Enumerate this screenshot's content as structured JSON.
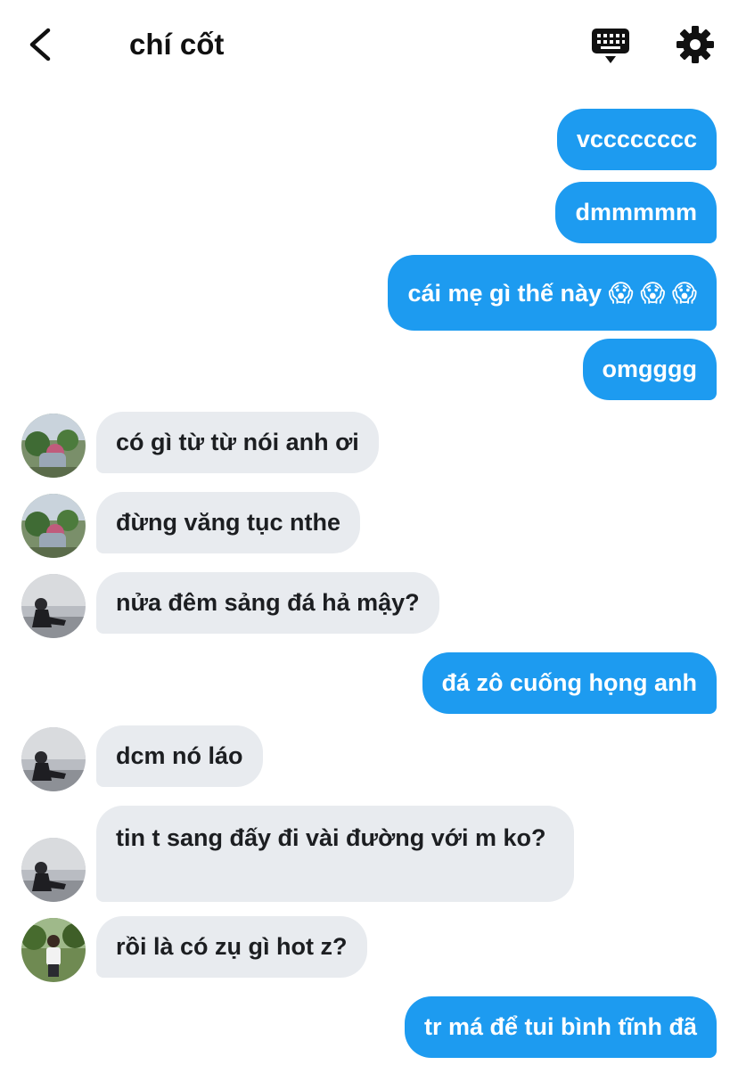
{
  "header": {
    "title": "chí cốt",
    "back_icon": "chevron-left-icon",
    "keyboard_icon": "keyboard-icon",
    "settings_icon": "gear-icon"
  },
  "colors": {
    "outgoing_bubble": "#1d9bf0",
    "incoming_bubble": "#e8ebef"
  },
  "messages": [
    {
      "direction": "out",
      "text": "vcccccccc"
    },
    {
      "direction": "out",
      "text": "dmmmmm"
    },
    {
      "direction": "out",
      "text": "cái mẹ gì thế này 😱 😱 😱"
    },
    {
      "direction": "out",
      "text": "omgggg"
    },
    {
      "direction": "in",
      "text": "có gì từ từ nói anh ơi"
    },
    {
      "direction": "in",
      "text": "đừng văng tục nthe"
    },
    {
      "direction": "in",
      "text": "nửa đêm sảng đá hả mậy?"
    },
    {
      "direction": "out",
      "text": "đá zô cuống họng anh"
    },
    {
      "direction": "in",
      "text": "dcm nó láo"
    },
    {
      "direction": "in",
      "text": "tin t sang đấy đi vài đường với m ko?"
    },
    {
      "direction": "in",
      "text": "rồi là có zụ gì hot z?"
    },
    {
      "direction": "out",
      "text": "tr má để tui bình tĩnh đã"
    }
  ]
}
